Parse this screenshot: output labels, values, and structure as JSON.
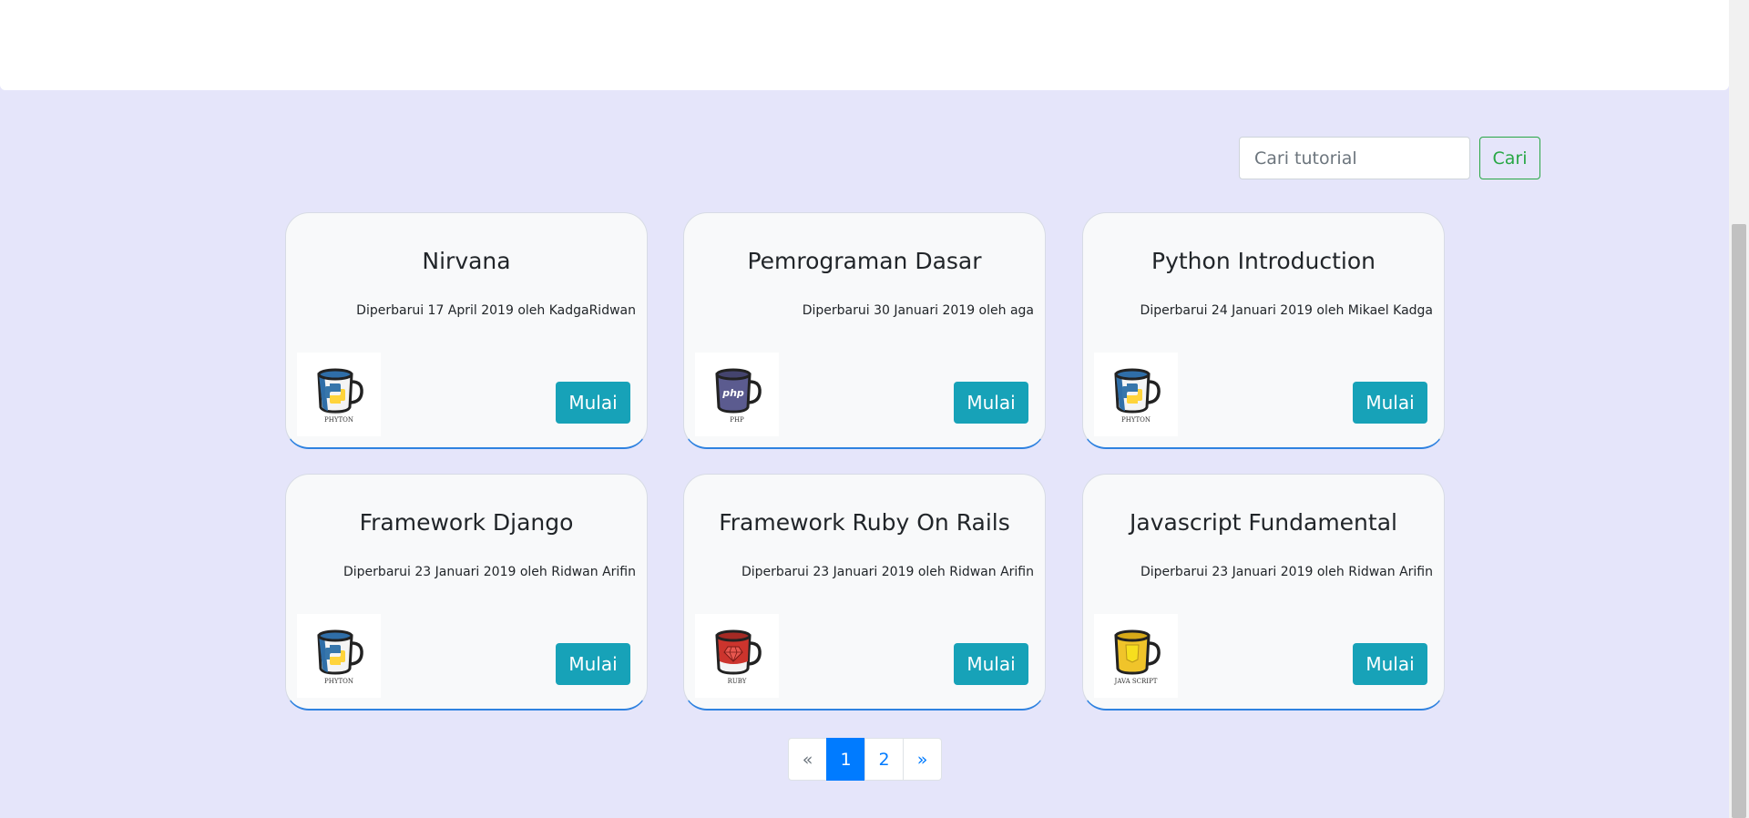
{
  "search": {
    "placeholder": "Cari tutorial",
    "button_label": "Cari"
  },
  "cards": [
    {
      "title": "Nirvana",
      "meta": "Diperbarui 17 April 2019 oleh KadgaRidwan",
      "thumb_label": "PHYTON",
      "button_label": "Mulai"
    },
    {
      "title": "Pemrograman Dasar",
      "meta": "Diperbarui 30 Januari 2019 oleh aga",
      "thumb_label": "PHP",
      "thumb_text": "php",
      "button_label": "Mulai"
    },
    {
      "title": "Python Introduction",
      "meta": "Diperbarui 24 Januari 2019 oleh Mikael Kadga",
      "thumb_label": "PHYTON",
      "button_label": "Mulai"
    },
    {
      "title": "Framework Django",
      "meta": "Diperbarui 23 Januari 2019 oleh Ridwan Arifin",
      "thumb_label": "PHYTON",
      "button_label": "Mulai"
    },
    {
      "title": "Framework Ruby On Rails",
      "meta": "Diperbarui 23 Januari 2019 oleh Ridwan Arifin",
      "thumb_label": "RUBY",
      "button_label": "Mulai"
    },
    {
      "title": "Javascript Fundamental",
      "meta": "Diperbarui 23 Januari 2019 oleh Ridwan Arifin",
      "thumb_label": "JAVA SCRIPT",
      "button_label": "Mulai"
    }
  ],
  "pagination": {
    "prev": "«",
    "pages": [
      "1",
      "2"
    ],
    "next": "»"
  }
}
